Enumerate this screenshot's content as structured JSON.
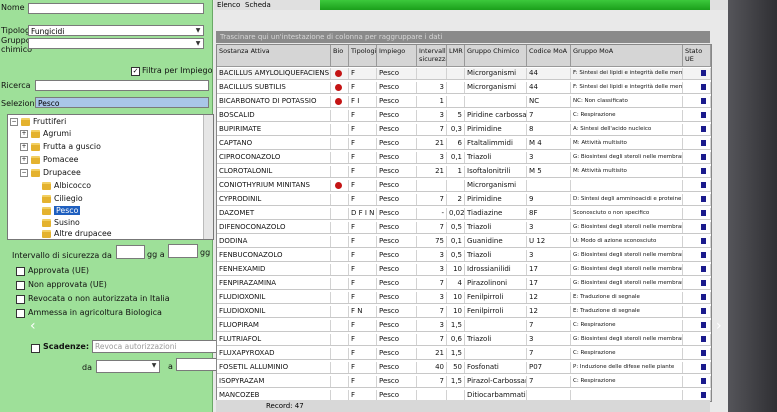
{
  "left": {
    "nome_label": "Nome",
    "nome_value": "",
    "tipologia_label": "Tipologia",
    "tipologia_value": "Fungicidi",
    "gruppo_label": "Gruppo",
    "gruppo_value": "",
    "chimico_label": "chimico",
    "filtra_label": "Filtra per Impiego",
    "filtra_checked": "✓",
    "ricerca_label": "Ricerca",
    "ricerca_value": "",
    "selezione_label": "Selezione",
    "selezione_value": "Pesco",
    "tree": {
      "root": "Fruttiferi",
      "agrumi": "Agrumi",
      "frutta_guscio": "Frutta a guscio",
      "pomacee": "Pomacee",
      "drupacee": "Drupacee",
      "albicocco": "Albicocco",
      "ciliegio": "Ciliegio",
      "pesco": "Pesco",
      "susino": "Susino",
      "altre": "Altre drupacee"
    },
    "intervallo_label": "Intervallo di sicurezza da",
    "gg_a": "gg a",
    "gg": "gg",
    "approvata": "Approvata (UE)",
    "non_approvata": "Non approvata (UE)",
    "revocata": "Revocata o non autorizzata in Italia",
    "ammessa": "Ammessa in agricoltura Biologica",
    "scadenze_label": "Scadenze:",
    "scadenze_placeholder": "Revoca autorizzazioni",
    "da_label": "da",
    "a_label": "a"
  },
  "tabs": [
    "Elenco",
    "Scheda"
  ],
  "search_placeholder": "Trascinare qui un'intestazione di colonna per raggruppare i dati",
  "columns": [
    "Sostanza Attiva",
    "Bio",
    "Tipologia",
    "Impiego",
    "Intervallo sicurezza",
    "LMR",
    "Gruppo Chimico",
    "Codice MoA",
    "Gruppo MoA",
    "Stato UE"
  ],
  "rows": [
    [
      "BACILLUS AMYLOLIQUEFACIENS",
      "bio",
      "F",
      "Pesco",
      "",
      "",
      "Microrganismi",
      "44",
      "F: Sintesi dei lipidi e integrità delle membrane"
    ],
    [
      "BACILLUS SUBTILIS",
      "bio",
      "F",
      "Pesco",
      "3",
      "",
      "Microrganismi",
      "44",
      "F: Sintesi dei lipidi e integrità delle membrane"
    ],
    [
      "BICARBONATO DI POTASSIO",
      "bio",
      "F I",
      "Pesco",
      "1",
      "",
      "",
      "NC",
      "NC: Non classificato"
    ],
    [
      "BOSCALID",
      "",
      "F",
      "Pesco",
      "3",
      "5",
      "Piridine carbossamidi",
      "7",
      "C: Respirazione"
    ],
    [
      "BUPIRIMATE",
      "",
      "F",
      "Pesco",
      "7",
      "0,3",
      "Pirimidine",
      "8",
      "A: Sintesi dell'acido nucleico"
    ],
    [
      "CAPTANO",
      "",
      "F",
      "Pesco",
      "21",
      "6",
      "Ftaltalimmidi",
      "M 4",
      "M: Attività multisito"
    ],
    [
      "CIPROCONAZOLO",
      "",
      "F",
      "Pesco",
      "3",
      "0,1",
      "Triazoli",
      "3",
      "G: Biosintesi degli steroli nelle membrane"
    ],
    [
      "CLOROTALONIL",
      "",
      "F",
      "Pesco",
      "21",
      "1",
      "Isoftalonitrili",
      "M 5",
      "M: Attività multisito"
    ],
    [
      "CONIOTHYRIUM MINITANS",
      "bio",
      "F",
      "Pesco",
      "",
      "",
      "Microrganismi",
      "",
      ""
    ],
    [
      "CYPRODINIL",
      "",
      "F",
      "Pesco",
      "7",
      "2",
      "Pirimidine",
      "9",
      "D: Sintesi degli amminoacidi e proteine"
    ],
    [
      "DAZOMET",
      "",
      "D F I N",
      "Pesco",
      "-",
      "0,02*",
      "Tiadiazine",
      "8F",
      "Sconosciuto o non specifico"
    ],
    [
      "DIFENOCONAZOLO",
      "",
      "F",
      "Pesco",
      "7",
      "0,5",
      "Triazoli",
      "3",
      "G: Biosintesi degli steroli nelle membrane"
    ],
    [
      "DODINA",
      "",
      "F",
      "Pesco",
      "75",
      "0,1",
      "Guanidine",
      "U 12",
      "U: Modo di azione sconosciuto"
    ],
    [
      "FENBUCONAZOLO",
      "",
      "F",
      "Pesco",
      "3",
      "0,5",
      "Triazoli",
      "3",
      "G: Biosintesi degli steroli nelle membrane"
    ],
    [
      "FENHEXAMID",
      "",
      "F",
      "Pesco",
      "3",
      "10",
      "Idrossianilidi",
      "17",
      "G: Biosintesi degli steroli nelle membrane"
    ],
    [
      "FENPIRAZAMINA",
      "",
      "F",
      "Pesco",
      "7",
      "4",
      "Pirazolinoni",
      "17",
      "G: Biosintesi degli steroli nelle membrane"
    ],
    [
      "FLUDIOXONIL",
      "",
      "F",
      "Pesco",
      "3",
      "10",
      "Fenilpirroli",
      "12",
      "E: Traduzione di segnale"
    ],
    [
      "FLUDIOXONIL",
      "",
      "F N",
      "Pesco",
      "7",
      "10",
      "Fenilpirroli",
      "12",
      "E: Traduzione di segnale"
    ],
    [
      "FLUOPIRAM",
      "",
      "F",
      "Pesco",
      "3",
      "1,5",
      "",
      "7",
      "C: Respirazione"
    ],
    [
      "FLUTRIAFOL",
      "",
      "F",
      "Pesco",
      "7",
      "0,6",
      "Triazoli",
      "3",
      "G: Biosintesi degli steroli nelle membrane"
    ],
    [
      "FLUXAPYROXAD",
      "",
      "F",
      "Pesco",
      "21",
      "1,5",
      "",
      "7",
      "C: Respirazione"
    ],
    [
      "FOSETIL ALLUMINIO",
      "",
      "F",
      "Pesco",
      "40",
      "50",
      "Fosfonati",
      "P07",
      "P: Induzione delle difese nelle piante"
    ],
    [
      "ISOPYRAZAM",
      "",
      "F",
      "Pesco",
      "7",
      "1,5",
      "Pirazol-Carbossammidi",
      "7",
      "C: Respirazione"
    ],
    [
      "MANCOZEB",
      "",
      "F",
      "Pesco",
      "",
      "",
      "Ditiocarbammati",
      "",
      ""
    ]
  ],
  "record_label": "Record: 47",
  "colors": {
    "panel": "#9ee099",
    "bio": "#c41414",
    "stato": "#1a1a8c",
    "accent": "#1b9f1b"
  }
}
